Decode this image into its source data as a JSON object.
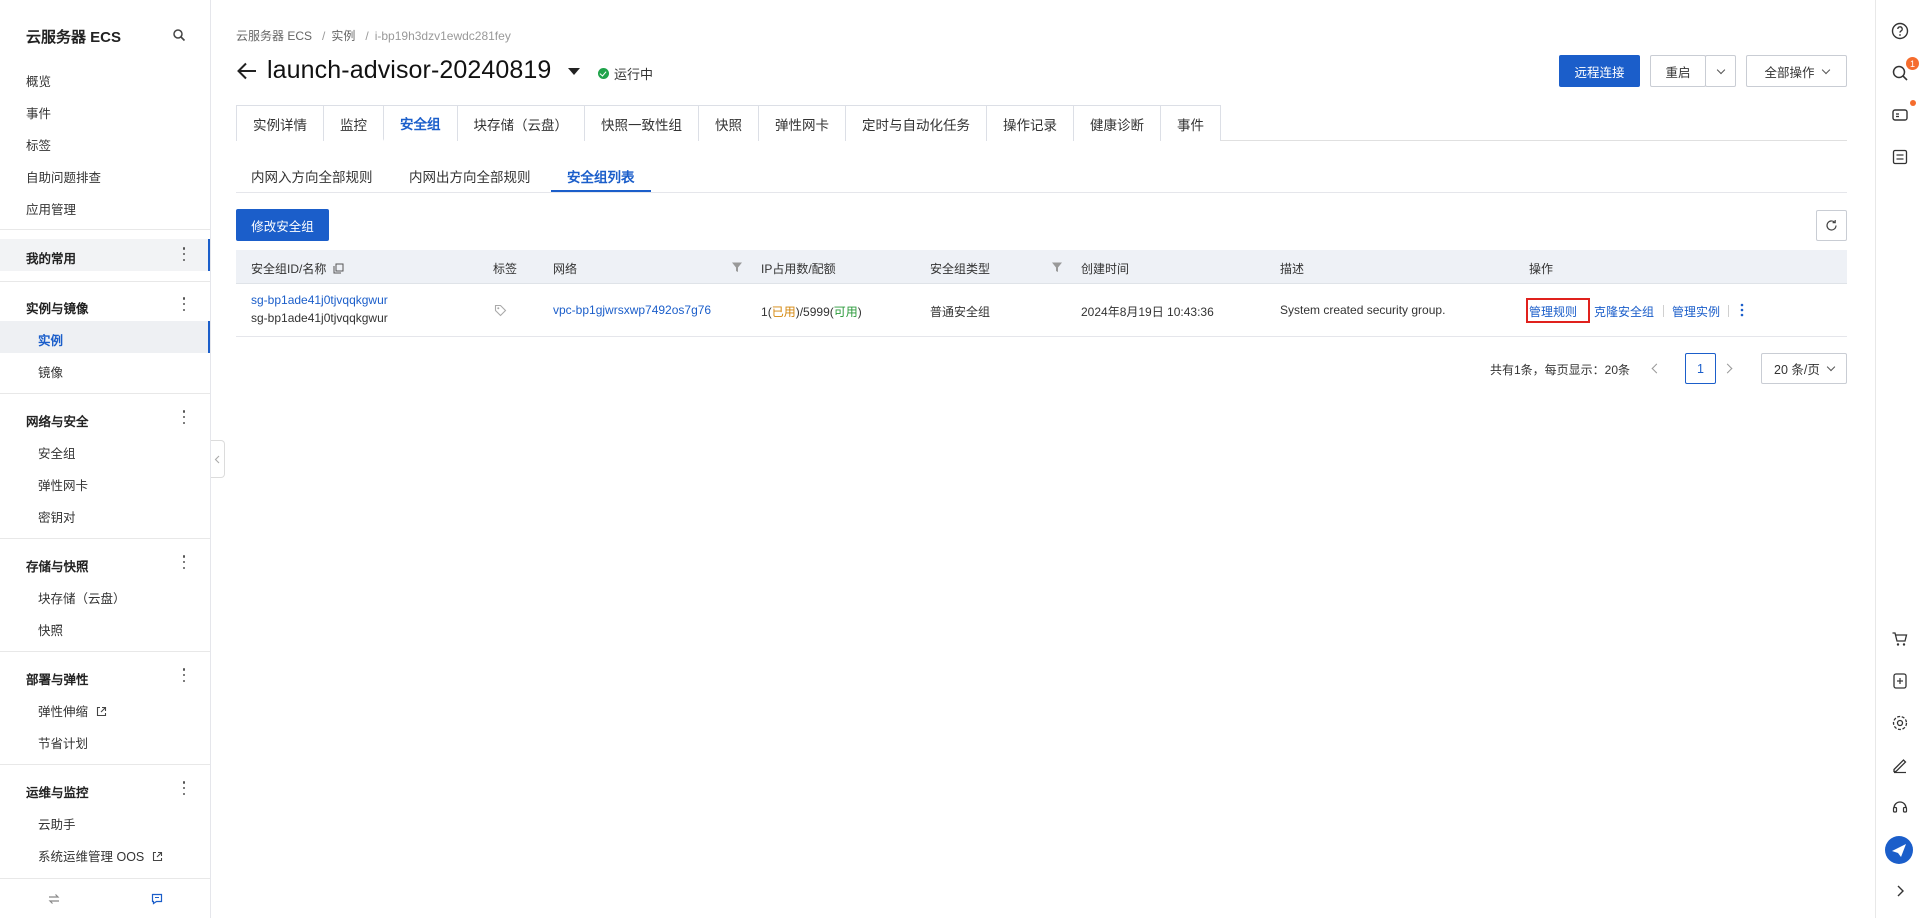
{
  "sidebar": {
    "title": "云服务器 ECS",
    "top_items": [
      "概览",
      "事件",
      "标签",
      "自助问题排查",
      "应用管理"
    ],
    "groups": [
      {
        "title": "我的常用",
        "items": []
      },
      {
        "title": "实例与镜像",
        "items": [
          "实例",
          "镜像"
        ]
      },
      {
        "title": "网络与安全",
        "items": [
          "安全组",
          "弹性网卡",
          "密钥对"
        ]
      },
      {
        "title": "存储与快照",
        "items": [
          "块存储（云盘）",
          "快照"
        ]
      },
      {
        "title": "部署与弹性",
        "items": [
          "弹性伸缩",
          "节省计划"
        ]
      },
      {
        "title": "运维与监控",
        "items": [
          "云助手",
          "系统运维管理 OOS"
        ]
      }
    ],
    "active_item": "实例"
  },
  "breadcrumb": [
    "云服务器 ECS",
    "实例",
    "i-bp19h3dzv1ewdc281fey"
  ],
  "header": {
    "title": "launch-advisor-20240819",
    "status": "运行中",
    "remote_connect": "远程连接",
    "restart": "重启",
    "all_actions": "全部操作"
  },
  "tabs": [
    "实例详情",
    "监控",
    "安全组",
    "块存储（云盘）",
    "快照一致性组",
    "快照",
    "弹性网卡",
    "定时与自动化任务",
    "操作记录",
    "健康诊断",
    "事件"
  ],
  "active_tab": "安全组",
  "subtabs": [
    "内网入方向全部规则",
    "内网出方向全部规则",
    "安全组列表"
  ],
  "active_subtab": "安全组列表",
  "modify_button": "修改安全组",
  "table": {
    "columns": [
      "安全组ID/名称",
      "标签",
      "网络",
      "IP占用数/配额",
      "安全组类型",
      "创建时间",
      "描述",
      "操作"
    ],
    "row": {
      "id": "sg-bp1ade41j0tjvqqkgwur",
      "name": "sg-bp1ade41j0tjvqqkgwur",
      "network": "vpc-bp1gjwrsxwp7492os7g76",
      "ip_used": "1",
      "ip_used_label": "已用",
      "ip_quota": "5999",
      "ip_quota_label": "可用",
      "type": "普通安全组",
      "created": "2024年8月19日 10:43:36",
      "description": "System created security group.",
      "actions": [
        "管理规则",
        "克隆安全组",
        "管理实例"
      ]
    }
  },
  "pagination": {
    "summary": "共有1条，每页显示：20条",
    "current_page": "1",
    "page_size": "20 条/页"
  },
  "rail": {
    "search_badge": "1"
  },
  "colors": {
    "primary": "#1b5eca",
    "status_green": "#1fa34a",
    "highlight_red": "#e0211d",
    "used_orange": "#d4860b",
    "available_green": "#2a9a3a"
  }
}
